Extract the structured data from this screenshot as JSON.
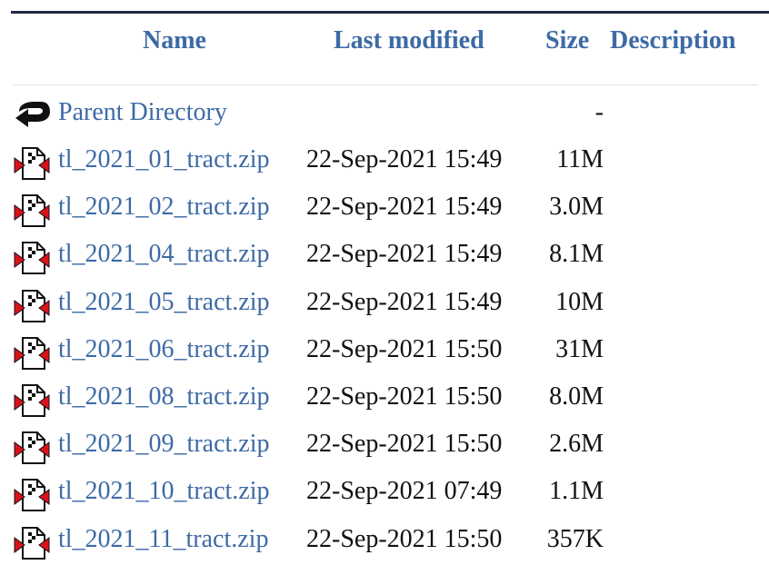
{
  "columns": {
    "name": "Name",
    "last_modified": "Last modified",
    "size": "Size",
    "description": "Description"
  },
  "parent": {
    "label": "Parent Directory",
    "size": "-",
    "icon": "back-arrow-icon"
  },
  "files": [
    {
      "name": "tl_2021_01_tract.zip",
      "modified": "22-Sep-2021 15:49",
      "size": "11M",
      "icon": "compressed-file-icon"
    },
    {
      "name": "tl_2021_02_tract.zip",
      "modified": "22-Sep-2021 15:49",
      "size": "3.0M",
      "icon": "compressed-file-icon"
    },
    {
      "name": "tl_2021_04_tract.zip",
      "modified": "22-Sep-2021 15:49",
      "size": "8.1M",
      "icon": "compressed-file-icon"
    },
    {
      "name": "tl_2021_05_tract.zip",
      "modified": "22-Sep-2021 15:49",
      "size": "10M",
      "icon": "compressed-file-icon"
    },
    {
      "name": "tl_2021_06_tract.zip",
      "modified": "22-Sep-2021 15:50",
      "size": "31M",
      "icon": "compressed-file-icon"
    },
    {
      "name": "tl_2021_08_tract.zip",
      "modified": "22-Sep-2021 15:50",
      "size": "8.0M",
      "icon": "compressed-file-icon"
    },
    {
      "name": "tl_2021_09_tract.zip",
      "modified": "22-Sep-2021 15:50",
      "size": "2.6M",
      "icon": "compressed-file-icon"
    },
    {
      "name": "tl_2021_10_tract.zip",
      "modified": "22-Sep-2021 07:49",
      "size": "1.1M",
      "icon": "compressed-file-icon"
    },
    {
      "name": "tl_2021_11_tract.zip",
      "modified": "22-Sep-2021 15:50",
      "size": "357K",
      "icon": "compressed-file-icon"
    }
  ],
  "colors": {
    "link": "#3d6aa6",
    "rule": "#1f2a44",
    "icon_red": "#d8121a"
  }
}
